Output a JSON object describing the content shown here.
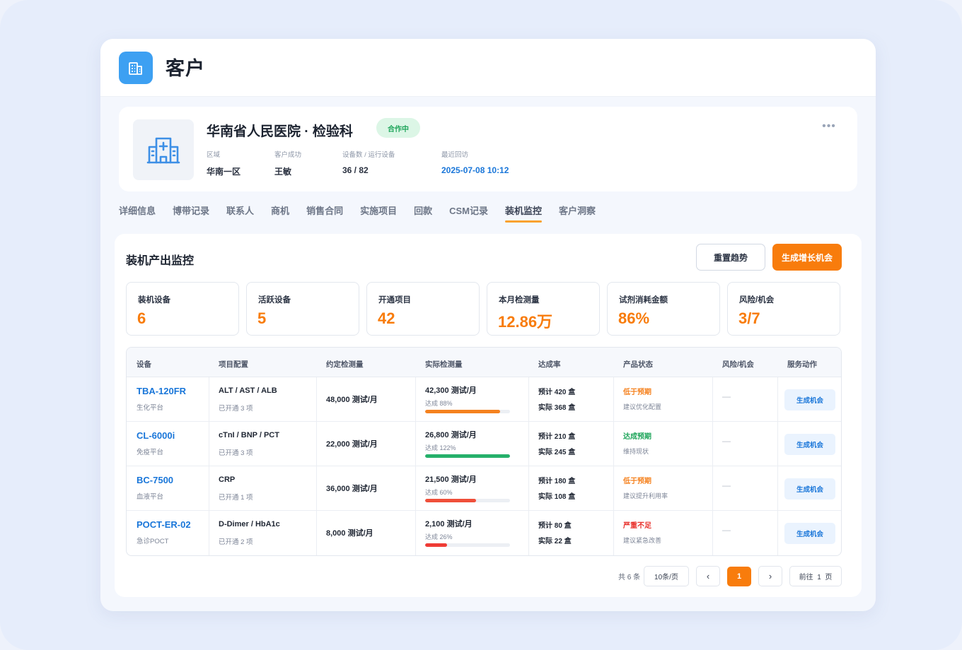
{
  "app": {
    "title": "客户",
    "icon": "building-icon"
  },
  "profile": {
    "name": "华南省人民医院 · 检验科",
    "status": "合作中",
    "avatar_icon": "hospital-icon",
    "meta": [
      {
        "label": "区域",
        "value": "华南一区"
      },
      {
        "label": "客户成功",
        "value": "王敏"
      },
      {
        "label": "设备数 / 运行设备",
        "value": "36 / 82"
      },
      {
        "label": "最近回访",
        "value": "2025-07-08 10:12"
      }
    ],
    "more_icon": "more-dots-icon"
  },
  "tabs": [
    "详细信息",
    "博带记录",
    "联系人",
    "商机",
    "销售合同",
    "实施项目",
    "回款",
    "CSM记录",
    "装机监控",
    "客户洞察"
  ],
  "active_tab": "装机监控",
  "panel": {
    "title": "装机产出监控",
    "reset_label": "重置趋势",
    "generate_label": "生成增长机会"
  },
  "kpis": [
    {
      "label": "装机设备",
      "value": "6"
    },
    {
      "label": "活跃设备",
      "value": "5"
    },
    {
      "label": "开通项目",
      "value": "42"
    },
    {
      "label": "本月检测量",
      "value": "12.86万"
    },
    {
      "label": "试剂消耗金额",
      "value": "86%"
    },
    {
      "label": "风险/机会",
      "value": "3/7"
    }
  ],
  "table": {
    "headers": [
      "设备",
      "项目配置",
      "约定检测量",
      "实际检测量",
      "达成率",
      "产品状态",
      "风险/机会",
      "服务动作"
    ],
    "rows": [
      {
        "device": "TBA-120FR",
        "platform": "生化平台",
        "items": "ALT / AST / ALB",
        "items_note": "已开通 3 项",
        "contract": "48,000 测试/月",
        "actual": "42,300 测试/月",
        "achieve": "达成 88%",
        "achieve_pct": 88,
        "bar_color": "#f5821f",
        "plan": "预计 420 盒",
        "real": "实际 368 盒",
        "status": "低于预期",
        "status_color": "#f5821f",
        "status_note": "建议优化配置",
        "risk": "—",
        "action": "生成机会"
      },
      {
        "device": "CL-6000i",
        "platform": "免疫平台",
        "items": "cTnI / BNP / PCT",
        "items_note": "已开通 3 项",
        "contract": "22,000 测试/月",
        "actual": "26,800 测试/月",
        "achieve": "达成 122%",
        "achieve_pct": 100,
        "bar_color": "#25b06a",
        "plan": "预计 210 盒",
        "real": "实际 245 盒",
        "status": "达成预期",
        "status_color": "#1ea55a",
        "status_note": "维持现状",
        "risk": "—",
        "action": "生成机会"
      },
      {
        "device": "BC-7500",
        "platform": "血液平台",
        "items": "CRP",
        "items_note": "已开通 1 项",
        "contract": "36,000 测试/月",
        "actual": "21,500 测试/月",
        "achieve": "达成 60%",
        "achieve_pct": 60,
        "bar_color": "#ef4f3a",
        "plan": "预计 180 盒",
        "real": "实际 108 盒",
        "status": "低于预期",
        "status_color": "#f5821f",
        "status_note": "建议提升利用率",
        "risk": "—",
        "action": "生成机会"
      },
      {
        "device": "POCT-ER-02",
        "platform": "急诊POCT",
        "items": "D-Dimer / HbA1c",
        "items_note": "已开通 2 项",
        "contract": "8,000 测试/月",
        "actual": "2,100 测试/月",
        "achieve": "达成 26%",
        "achieve_pct": 26,
        "bar_color": "#ef3b35",
        "plan": "预计 80 盒",
        "real": "实际 22 盒",
        "status": "严重不足",
        "status_color": "#e8302b",
        "status_note": "建议紧急改善",
        "risk": "—",
        "action": "生成机会"
      }
    ]
  },
  "pager": {
    "total": "共 6 条",
    "page_size": "10条/页",
    "prev": "‹",
    "current": "1",
    "next": "›",
    "goto": "前往  1  页"
  }
}
